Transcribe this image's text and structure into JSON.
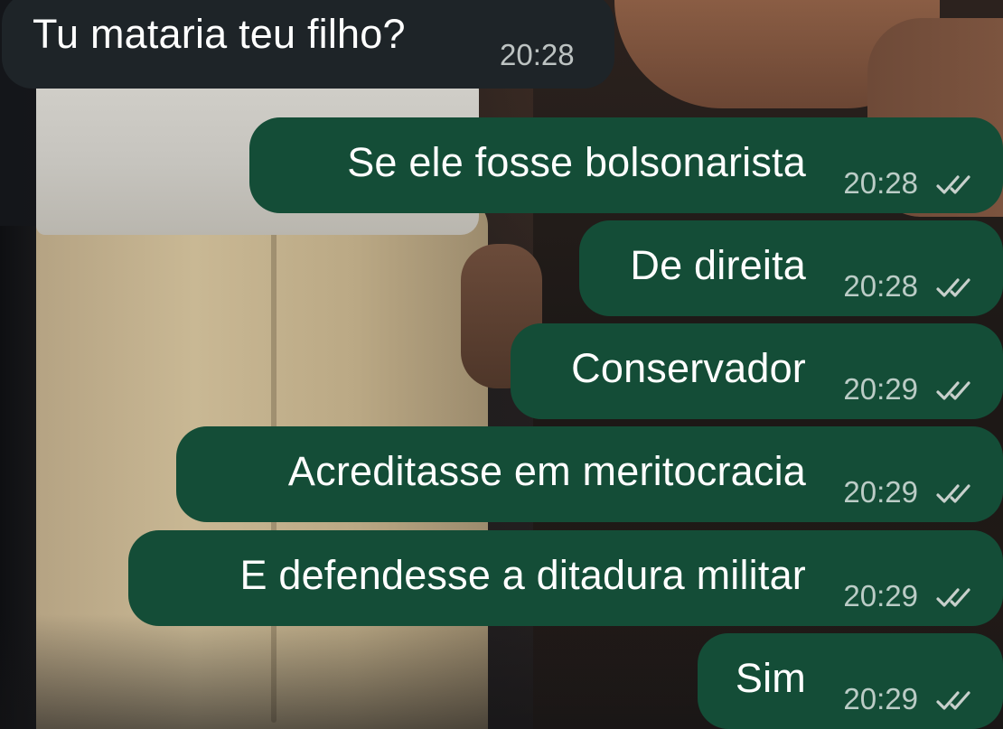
{
  "chat": {
    "messages": [
      {
        "direction": "incoming",
        "text": "Tu mataria teu filho?",
        "time": "20:28",
        "status": null
      },
      {
        "direction": "outgoing",
        "text": "Se ele fosse bolsonarista",
        "time": "20:28",
        "status": "read-ticks-icon"
      },
      {
        "direction": "outgoing",
        "text": "De direita",
        "time": "20:28",
        "status": "read-ticks-icon"
      },
      {
        "direction": "outgoing",
        "text": "Conservador",
        "time": "20:29",
        "status": "read-ticks-icon"
      },
      {
        "direction": "outgoing",
        "text": "Acreditasse em meritocracia",
        "time": "20:29",
        "status": "read-ticks-icon"
      },
      {
        "direction": "outgoing",
        "text": "E defendesse a ditadura militar",
        "time": "20:29",
        "status": "read-ticks-icon"
      },
      {
        "direction": "outgoing",
        "text": "Sim",
        "time": "20:29",
        "status": "read-ticks-icon"
      }
    ]
  },
  "colors": {
    "incoming_bubble": "#1e2428",
    "outgoing_bubble": "#144d37",
    "text": "#ffffff",
    "timestamp": "#c8d0cc"
  }
}
